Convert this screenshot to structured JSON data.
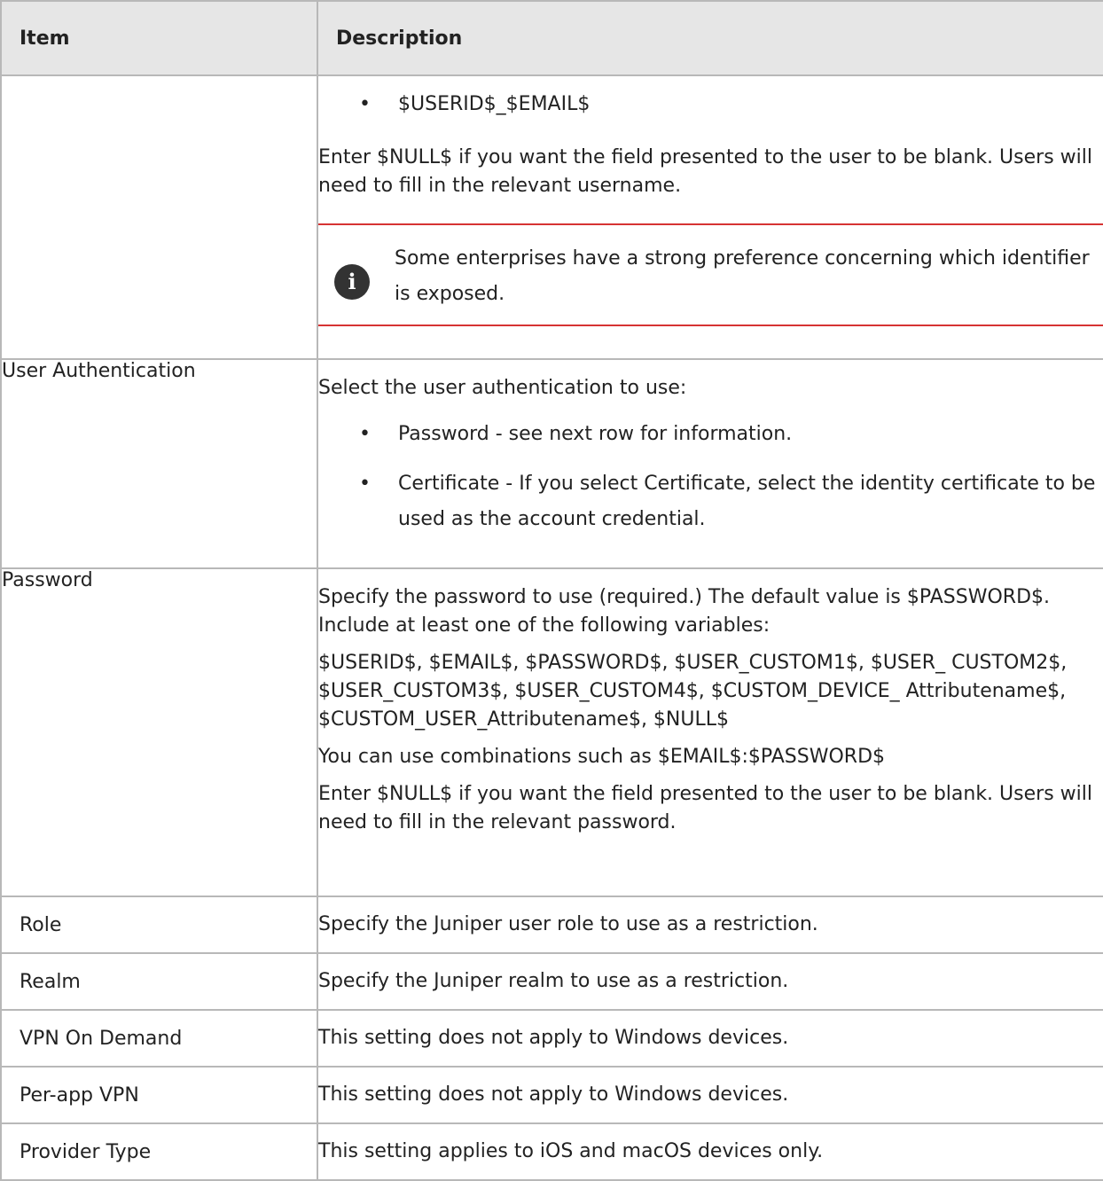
{
  "header": {
    "item": "Item",
    "description": "Description"
  },
  "rows": {
    "continued": {
      "bullet": "$USERID$_$EMAIL$",
      "para": "Enter $NULL$ if you want the field presented to the user to be blank. Users will need to fill in the relevant username.",
      "note": "Some enterprises have a strong preference concerning which identifier is exposed."
    },
    "user_auth": {
      "item": "User Authentication",
      "intro": "Select the user authentication to use:",
      "bullets": [
        "Password - see next row for information.",
        "Certificate - If you select Certificate, select the identity certificate to be used as the account credential."
      ]
    },
    "password": {
      "item": "Password",
      "paras": [
        "Specify the password to use (required.) The default value is $PASSWORD$. Include at least one of the following variables:",
        "$USERID$, $EMAIL$, $PASSWORD$, $USER_CUSTOM1$, $USER_ CUSTOM2$, $USER_CUSTOM3$, $USER_CUSTOM4$, $CUSTOM_DEVICE_ Attributename$, $CUSTOM_USER_Attributename$, $NULL$",
        "You can use combinations such as $EMAIL$:$PASSWORD$",
        "Enter $NULL$ if you want the field presented to the user to be blank. Users will need to fill in the relevant password."
      ]
    },
    "role": {
      "item": "Role",
      "desc": "Specify the Juniper user role to use as a restriction."
    },
    "realm": {
      "item": "Realm",
      "desc": "Specify the Juniper realm to use as a restriction."
    },
    "vpn_on_demand": {
      "item": "VPN On Demand",
      "desc": "This setting does not apply to Windows devices."
    },
    "per_app_vpn": {
      "item": "Per-app VPN",
      "desc": "This setting does not apply to Windows devices."
    },
    "provider_type": {
      "item": "Provider Type",
      "desc": "This setting applies to iOS and macOS devices only."
    }
  },
  "colors": {
    "note_rule": "#d63333",
    "header_bg": "#e6e6e6",
    "border": "#b8b8b8"
  },
  "icons": {
    "note": "info-icon"
  }
}
